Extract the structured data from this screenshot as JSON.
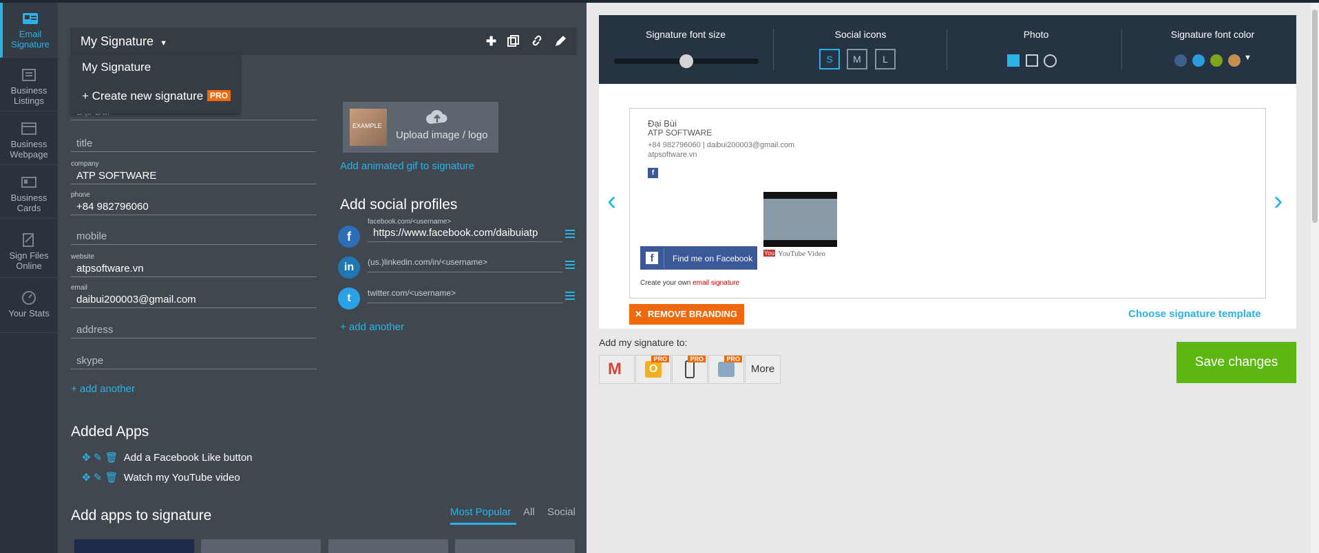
{
  "nav": {
    "items": [
      {
        "label1": "Email",
        "label2": "Signature",
        "icon": "email-signature-icon"
      },
      {
        "label1": "Business",
        "label2": "Listings",
        "icon": "listings-icon"
      },
      {
        "label1": "Business",
        "label2": "Webpage",
        "icon": "webpage-icon"
      },
      {
        "label1": "Business",
        "label2": "Cards",
        "icon": "cards-icon"
      },
      {
        "label1": "Sign Files",
        "label2": "Online",
        "icon": "sign-files-icon"
      },
      {
        "label1": "Your Stats",
        "label2": "",
        "icon": "stats-icon"
      }
    ]
  },
  "signature_menu": {
    "current": "My Signature",
    "options": [
      "My Signature",
      "+ Create new signature"
    ],
    "pro_badge": "PRO"
  },
  "fields": {
    "name": {
      "value": "Đại Bùi"
    },
    "title": {
      "placeholder": "title"
    },
    "company": {
      "label": "company",
      "value": "ATP SOFTWARE"
    },
    "phone": {
      "label": "phone",
      "value": "+84 982796060"
    },
    "mobile": {
      "placeholder": "mobile"
    },
    "website": {
      "label": "website",
      "value": "atpsoftware.vn"
    },
    "email": {
      "label": "email",
      "value": "daibui200003@gmail.com"
    },
    "address": {
      "placeholder": "address"
    },
    "skype": {
      "placeholder": "skype"
    },
    "add_another": "+ add another"
  },
  "image": {
    "upload_label": "Upload image / logo",
    "example": "EXAMPLE",
    "gif_link": "Add animated gif to signature"
  },
  "social": {
    "title": "Add social profiles",
    "facebook": {
      "label": "facebook.com/<username>",
      "value": "https://www.facebook.com/daibuiatp"
    },
    "linkedin": {
      "placeholder": "(us.)linkedin.com/in/<username>"
    },
    "twitter": {
      "placeholder": "twitter.com/<username>"
    },
    "add_another": "+ add another"
  },
  "added_apps": {
    "title": "Added Apps",
    "items": [
      "Add a Facebook Like button",
      "Watch my YouTube video"
    ]
  },
  "apps": {
    "title": "Add apps to signature",
    "tabs": [
      "Most Popular",
      "All",
      "Social"
    ]
  },
  "toolbar": {
    "font_size_label": "Signature font size",
    "font_size_value": 0.5,
    "social_icons_label": "Social icons",
    "sizes": [
      "S",
      "M",
      "L"
    ],
    "photo_label": "Photo",
    "font_color_label": "Signature font color",
    "colors": [
      "#3f5f8c",
      "#2a9fe0",
      "#7fa51b",
      "#c58e50"
    ]
  },
  "preview": {
    "name": "Đại Bùi",
    "company": "ATP SOFTWARE",
    "contact": "+84 982796060 | daibui200003@gmail.com",
    "website": "atpsoftware.vn",
    "fb_button": "Find me on Facebook",
    "youtube": "YouTube Video",
    "footer_prefix": "Create your own ",
    "footer_link": "email signature"
  },
  "remove_branding": "REMOVE BRANDING",
  "choose_template": "Choose signature template",
  "add_to": {
    "label": "Add my signature to:",
    "more": "More",
    "pro": "PRO"
  },
  "save": "Save changes"
}
